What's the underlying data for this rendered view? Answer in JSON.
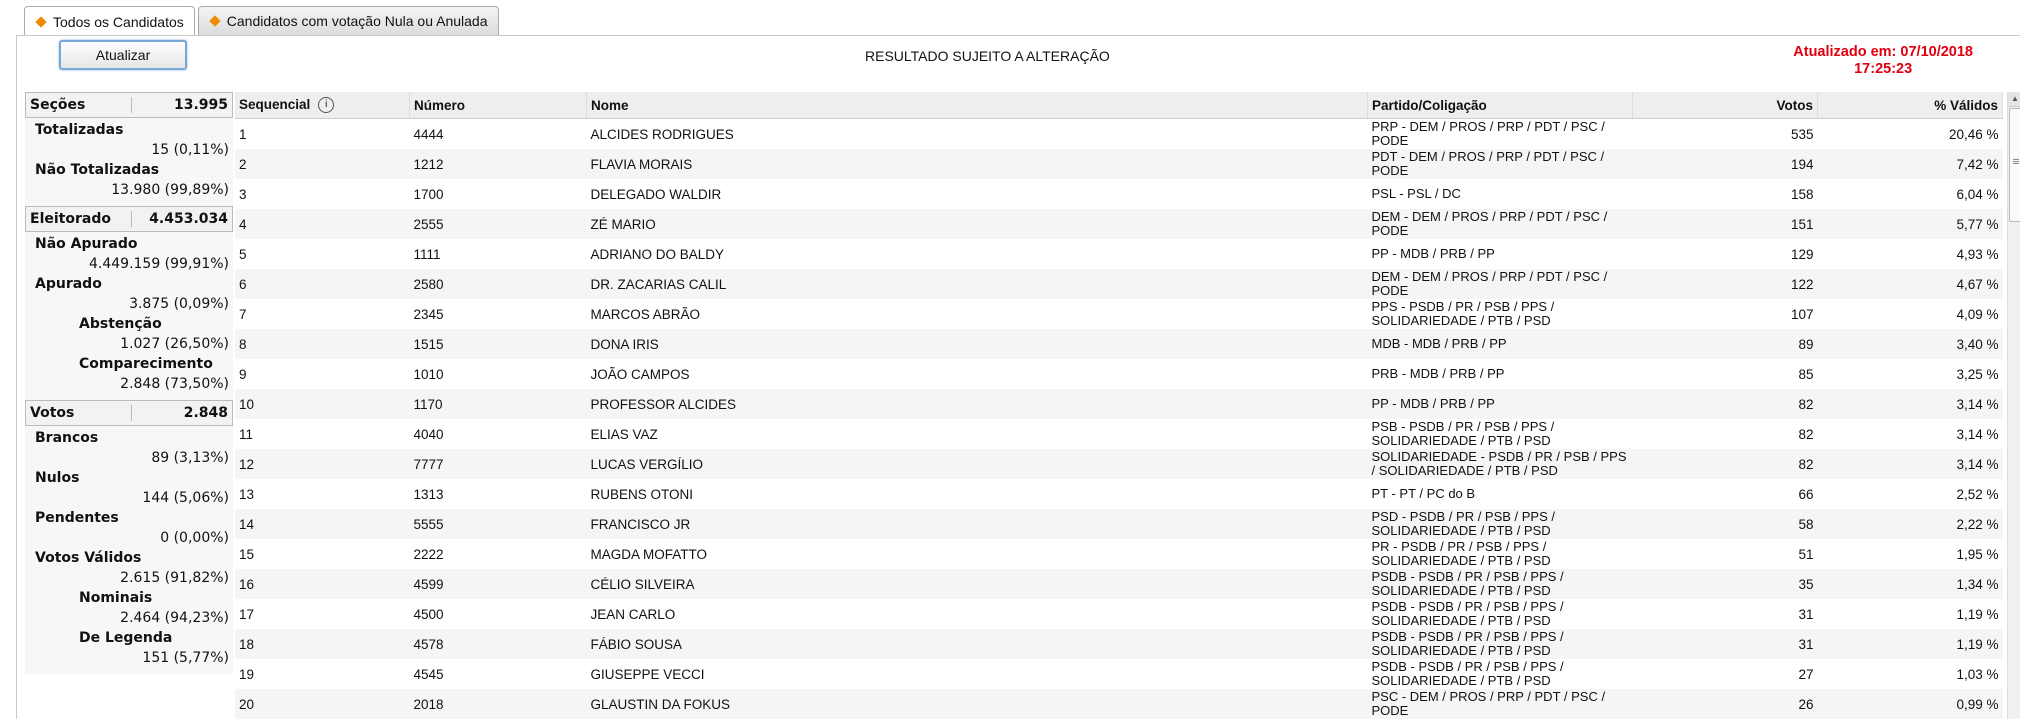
{
  "tabs": [
    {
      "label": "Todos os Candidatos",
      "active": true
    },
    {
      "label": "Candidatos com votação Nula ou Anulada",
      "active": false
    }
  ],
  "toolbar": {
    "update_label": "Atualizar",
    "notice": "RESULTADO SUJEITO A ALTERAÇÃO",
    "updated_line1": "Atualizado em: 07/10/2018",
    "updated_line2": "17:25:23"
  },
  "stats": {
    "secoes": {
      "label": "Seções",
      "value": "13.995"
    },
    "totalizadas": {
      "label": "Totalizadas",
      "value": "15 (0,11%)"
    },
    "nao_totalizadas": {
      "label": "Não Totalizadas",
      "value": "13.980 (99,89%)"
    },
    "eleitorado": {
      "label": "Eleitorado",
      "value": "4.453.034"
    },
    "nao_apurado": {
      "label": "Não Apurado",
      "value": "4.449.159 (99,91%)"
    },
    "apurado": {
      "label": "Apurado",
      "value": "3.875 (0,09%)"
    },
    "abstencao": {
      "label": "Abstenção",
      "value": "1.027 (26,50%)"
    },
    "comparecimento": {
      "label": "Comparecimento",
      "value": "2.848 (73,50%)"
    },
    "votos": {
      "label": "Votos",
      "value": "2.848"
    },
    "brancos": {
      "label": "Brancos",
      "value": "89 (3,13%)"
    },
    "nulos": {
      "label": "Nulos",
      "value": "144 (5,06%)"
    },
    "pendentes": {
      "label": "Pendentes",
      "value": "0 (0,00%)"
    },
    "votos_validos": {
      "label": "Votos Válidos",
      "value": "2.615 (91,82%)"
    },
    "nominais": {
      "label": "Nominais",
      "value": "2.464 (94,23%)"
    },
    "de_legenda": {
      "label": "De Legenda",
      "value": "151 (5,77%)"
    }
  },
  "table": {
    "headers": {
      "seq": "Sequencial",
      "numero": "Número",
      "nome": "Nome",
      "partido": "Partido/Coligação",
      "votos": "Votos",
      "validos": "% Válidos"
    },
    "info_icon": "i",
    "rows": [
      {
        "seq": "1",
        "numero": "4444",
        "nome": "ALCIDES RODRIGUES",
        "partido": "PRP - DEM / PROS / PRP / PDT / PSC / PODE",
        "votos": "535",
        "validos": "20,46 %"
      },
      {
        "seq": "2",
        "numero": "1212",
        "nome": "FLAVIA MORAIS",
        "partido": "PDT - DEM / PROS / PRP / PDT / PSC / PODE",
        "votos": "194",
        "validos": "7,42 %"
      },
      {
        "seq": "3",
        "numero": "1700",
        "nome": "DELEGADO WALDIR",
        "partido": "PSL - PSL / DC",
        "votos": "158",
        "validos": "6,04 %"
      },
      {
        "seq": "4",
        "numero": "2555",
        "nome": "ZÉ MARIO",
        "partido": "DEM - DEM / PROS / PRP / PDT / PSC / PODE",
        "votos": "151",
        "validos": "5,77 %"
      },
      {
        "seq": "5",
        "numero": "1111",
        "nome": "ADRIANO DO BALDY",
        "partido": "PP - MDB / PRB / PP",
        "votos": "129",
        "validos": "4,93 %"
      },
      {
        "seq": "6",
        "numero": "2580",
        "nome": "DR. ZACARIAS CALIL",
        "partido": "DEM - DEM / PROS / PRP / PDT / PSC / PODE",
        "votos": "122",
        "validos": "4,67 %"
      },
      {
        "seq": "7",
        "numero": "2345",
        "nome": "MARCOS ABRÃO",
        "partido": "PPS - PSDB / PR / PSB / PPS / SOLIDARIEDADE / PTB / PSD",
        "votos": "107",
        "validos": "4,09 %"
      },
      {
        "seq": "8",
        "numero": "1515",
        "nome": "DONA IRIS",
        "partido": "MDB - MDB / PRB / PP",
        "votos": "89",
        "validos": "3,40 %"
      },
      {
        "seq": "9",
        "numero": "1010",
        "nome": "JOÃO CAMPOS",
        "partido": "PRB - MDB / PRB / PP",
        "votos": "85",
        "validos": "3,25 %"
      },
      {
        "seq": "10",
        "numero": "1170",
        "nome": "PROFESSOR ALCIDES",
        "partido": "PP - MDB / PRB / PP",
        "votos": "82",
        "validos": "3,14 %"
      },
      {
        "seq": "11",
        "numero": "4040",
        "nome": "ELIAS VAZ",
        "partido": "PSB - PSDB / PR / PSB / PPS / SOLIDARIEDADE / PTB / PSD",
        "votos": "82",
        "validos": "3,14 %"
      },
      {
        "seq": "12",
        "numero": "7777",
        "nome": "LUCAS VERGÍLIO",
        "partido": "SOLIDARIEDADE - PSDB / PR / PSB / PPS / SOLIDARIEDADE / PTB / PSD",
        "votos": "82",
        "validos": "3,14 %"
      },
      {
        "seq": "13",
        "numero": "1313",
        "nome": "RUBENS OTONI",
        "partido": "PT - PT / PC do B",
        "votos": "66",
        "validos": "2,52 %"
      },
      {
        "seq": "14",
        "numero": "5555",
        "nome": "FRANCISCO JR",
        "partido": "PSD - PSDB / PR / PSB / PPS / SOLIDARIEDADE / PTB / PSD",
        "votos": "58",
        "validos": "2,22 %"
      },
      {
        "seq": "15",
        "numero": "2222",
        "nome": "MAGDA MOFATTO",
        "partido": "PR - PSDB / PR / PSB / PPS / SOLIDARIEDADE / PTB / PSD",
        "votos": "51",
        "validos": "1,95 %"
      },
      {
        "seq": "16",
        "numero": "4599",
        "nome": "CÉLIO SILVEIRA",
        "partido": "PSDB - PSDB / PR / PSB / PPS / SOLIDARIEDADE / PTB / PSD",
        "votos": "35",
        "validos": "1,34 %"
      },
      {
        "seq": "17",
        "numero": "4500",
        "nome": "JEAN CARLO",
        "partido": "PSDB - PSDB / PR / PSB / PPS / SOLIDARIEDADE / PTB / PSD",
        "votos": "31",
        "validos": "1,19 %"
      },
      {
        "seq": "18",
        "numero": "4578",
        "nome": "FÁBIO SOUSA",
        "partido": "PSDB - PSDB / PR / PSB / PPS / SOLIDARIEDADE / PTB / PSD",
        "votos": "31",
        "validos": "1,19 %"
      },
      {
        "seq": "19",
        "numero": "4545",
        "nome": "GIUSEPPE VECCI",
        "partido": "PSDB - PSDB / PR / PSB / PPS / SOLIDARIEDADE / PTB / PSD",
        "votos": "27",
        "validos": "1,03 %"
      },
      {
        "seq": "20",
        "numero": "2018",
        "nome": "GLAUSTIN DA FOKUS",
        "partido": "PSC - DEM / PROS / PRP / PDT / PSC / PODE",
        "votos": "26",
        "validos": "0,99 %"
      }
    ]
  }
}
